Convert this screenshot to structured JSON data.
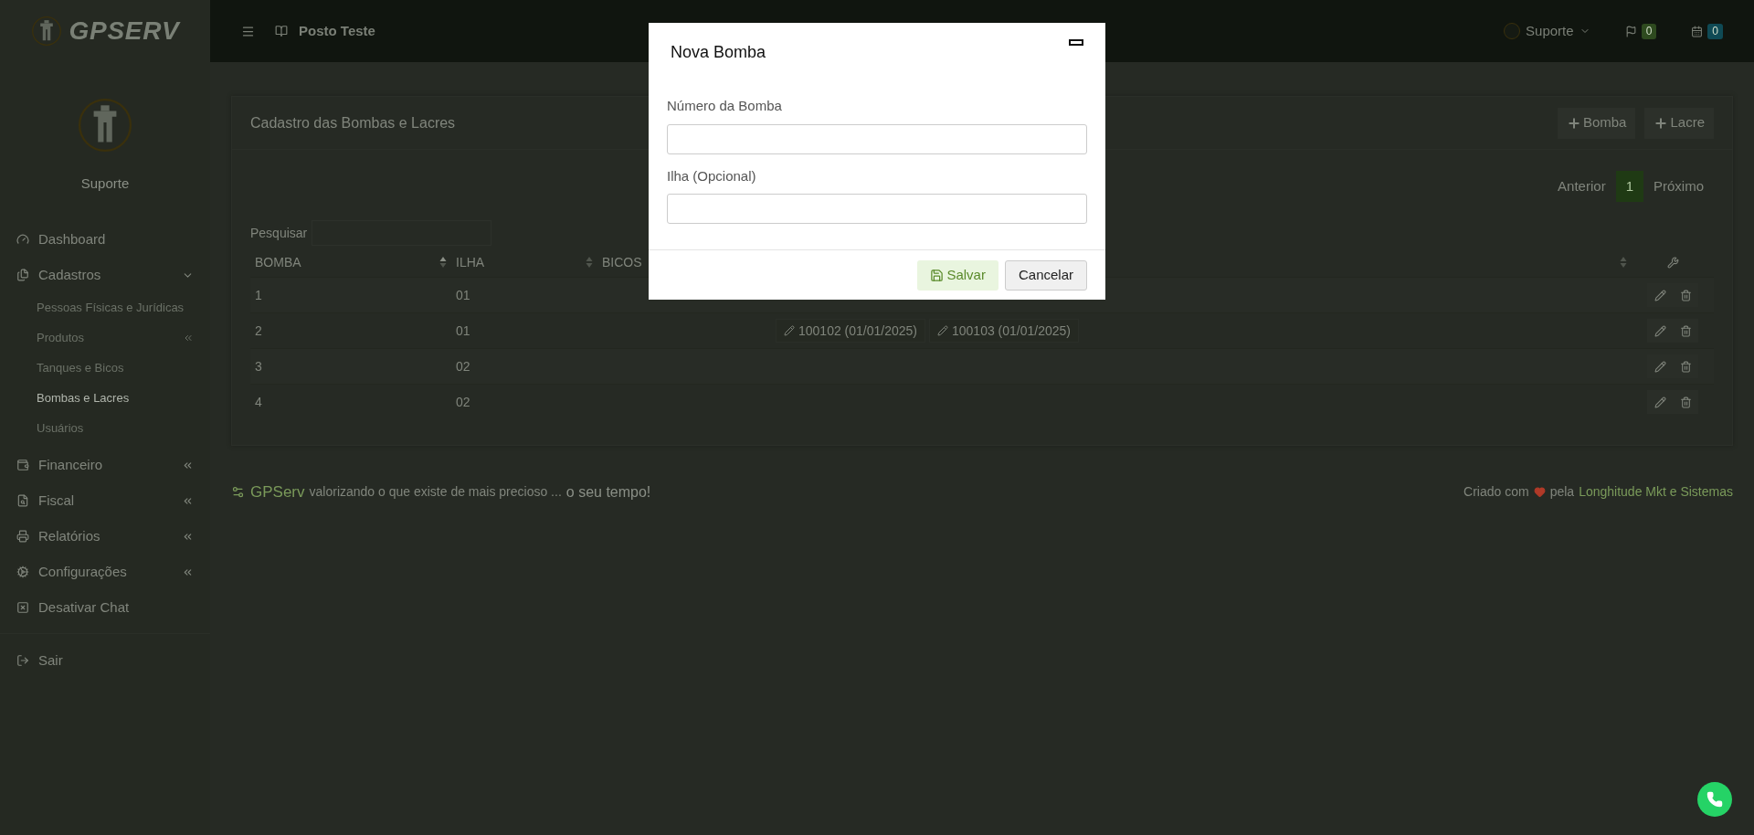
{
  "brand": {
    "logo_text": "GPSERV"
  },
  "sidebar": {
    "user": "Suporte",
    "items": [
      {
        "label": "Dashboard",
        "kind": "link"
      },
      {
        "label": "Cadastros",
        "kind": "group",
        "expanded": true,
        "children": [
          {
            "label": "Pessoas Físicas e Jurídicas",
            "selected": false
          },
          {
            "label": "Produtos",
            "selected": false,
            "expanded": false
          },
          {
            "label": "Tanques e Bicos",
            "selected": false
          },
          {
            "label": "Bombas e Lacres",
            "selected": true
          },
          {
            "label": "Usuários",
            "selected": false
          }
        ]
      },
      {
        "label": "Financeiro",
        "kind": "group",
        "expanded": false
      },
      {
        "label": "Fiscal",
        "kind": "group",
        "expanded": false
      },
      {
        "label": "Relatórios",
        "kind": "group",
        "expanded": false
      },
      {
        "label": "Configurações",
        "kind": "group",
        "expanded": false
      },
      {
        "label": "Desativar Chat",
        "kind": "link"
      }
    ],
    "logout": "Sair"
  },
  "topbar": {
    "company": "Posto Teste",
    "user": "Suporte",
    "badges": [
      {
        "count": "0",
        "color": "#2e4a1f"
      },
      {
        "count": "0",
        "color": "#0f4a55"
      }
    ]
  },
  "card": {
    "title": "Cadastro das Bombas e Lacres",
    "actions": [
      "Bomba",
      "Lacre"
    ],
    "pagination": [
      {
        "label": "Anterior",
        "selected": false
      },
      {
        "label": "1",
        "selected": true
      },
      {
        "label": "Próximo",
        "selected": false
      }
    ],
    "search": {
      "label": "Pesquisar"
    },
    "table": {
      "columns": [
        {
          "kind": "data",
          "label": "BOMBA",
          "sorted": true
        },
        {
          "kind": "data",
          "label": "ILHA",
          "sorted": false
        },
        {
          "kind": "data",
          "label": "BICOS"
        },
        {
          "kind": "data",
          "sorted": false
        },
        {
          "kind": "tools"
        }
      ],
      "rows": [
        {
          "bomba": "1",
          "ilha": "01"
        },
        {
          "bomba": "2",
          "ilha": "01",
          "lacres": [
            "100102 (01/01/2025)",
            "100103 (01/01/2025)"
          ]
        },
        {
          "bomba": "3",
          "ilha": "02"
        },
        {
          "bomba": "4",
          "ilha": "02"
        }
      ]
    }
  },
  "footer": {
    "brand": "GPServ",
    "slogan": "valorizando o que existe de mais precioso ...",
    "tagline": "o seu tempo!",
    "credit_prefix": "Criado com",
    "credit_middle": "pela",
    "credit_link": "Longhitude Mkt e Sistemas"
  },
  "modal": {
    "title": "Nova Bomba",
    "fields": [
      {
        "label": "Número da Bomba"
      },
      {
        "label": "Ilha (Opcional)"
      }
    ],
    "buttons": [
      {
        "label": "Salvar",
        "kind": "primary"
      },
      {
        "label": "Cancelar",
        "kind": "secondary"
      }
    ]
  }
}
